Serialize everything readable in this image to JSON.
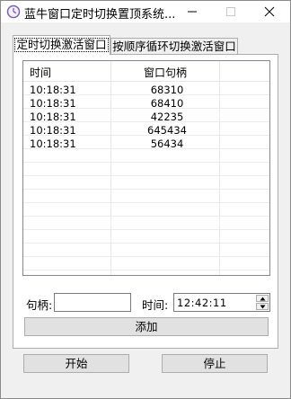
{
  "window": {
    "title": "蓝牛窗口定时切换置顶系统..."
  },
  "tabs": [
    {
      "label": "定时切换激活窗口",
      "active": true
    },
    {
      "label": "按顺序循环切换激活窗口",
      "active": false
    }
  ],
  "list": {
    "columns": [
      "时间",
      "窗口句柄"
    ],
    "rows": [
      {
        "time": "10:18:31",
        "handle": "68310"
      },
      {
        "time": "10:18:31",
        "handle": "68410"
      },
      {
        "time": "10:18:31",
        "handle": "42235"
      },
      {
        "time": "10:18:31",
        "handle": "645434"
      },
      {
        "time": "10:18:31",
        "handle": "56434"
      }
    ]
  },
  "form": {
    "handle_label": "句柄:",
    "handle_value": "",
    "time_label": "时间:",
    "time_value": "12:42:11",
    "add_label": "添加"
  },
  "footer": {
    "start_label": "开始",
    "stop_label": "停止"
  },
  "colors": {
    "accent": "#7a5cc0",
    "border": "#adadad",
    "button": "#e1e1e1"
  }
}
